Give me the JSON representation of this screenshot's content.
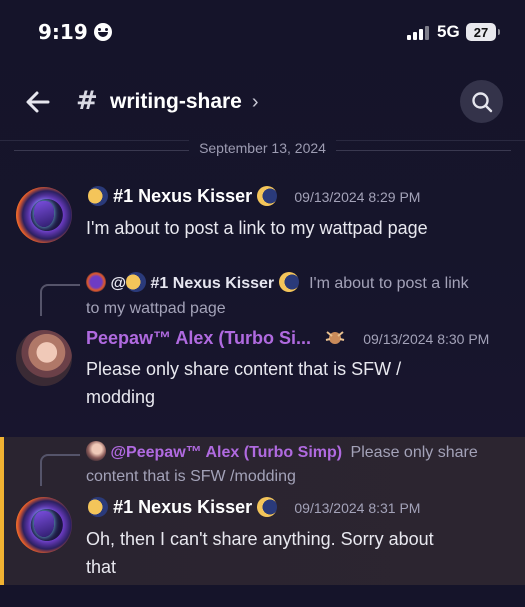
{
  "status_bar": {
    "time": "9:19",
    "network": "5G",
    "battery": "27"
  },
  "header": {
    "hash": "#",
    "channel_name": "writing-share",
    "chevron": "›"
  },
  "divider": {
    "date": "September 13, 2024"
  },
  "messages": [
    {
      "author": "#1 Nexus Kisser",
      "timestamp": "09/13/2024 8:29 PM",
      "text": "I'm about to post a link to my wattpad page"
    },
    {
      "reply_to": {
        "prefix": "@",
        "author": "#1 Nexus Kisser",
        "text_line1": "I'm about to post a link",
        "text_line2": "to my wattpad page"
      },
      "author": "Peepaw™ Alex (Turbo Si...",
      "timestamp": "09/13/2024 8:30 PM",
      "text_line1": "Please only share content that is SFW /",
      "text_line2": "modding"
    },
    {
      "reply_to": {
        "author": "@Peepaw™ Alex (Turbo Simp)",
        "text_line1": "Please only share",
        "text_line2": "content that is SFW /modding"
      },
      "author": "#1 Nexus Kisser",
      "timestamp": "09/13/2024 8:31 PM",
      "text_line1": "Oh, then I can't share anything. Sorry about",
      "text_line2": "that"
    }
  ],
  "colors": {
    "accent_highlight": "#f0b232",
    "role_purple": "#b06ae0",
    "background": "#16152b"
  },
  "icons": [
    "back-arrow-icon",
    "search-icon",
    "signal-icon",
    "battery-icon",
    "smiley-icon"
  ]
}
